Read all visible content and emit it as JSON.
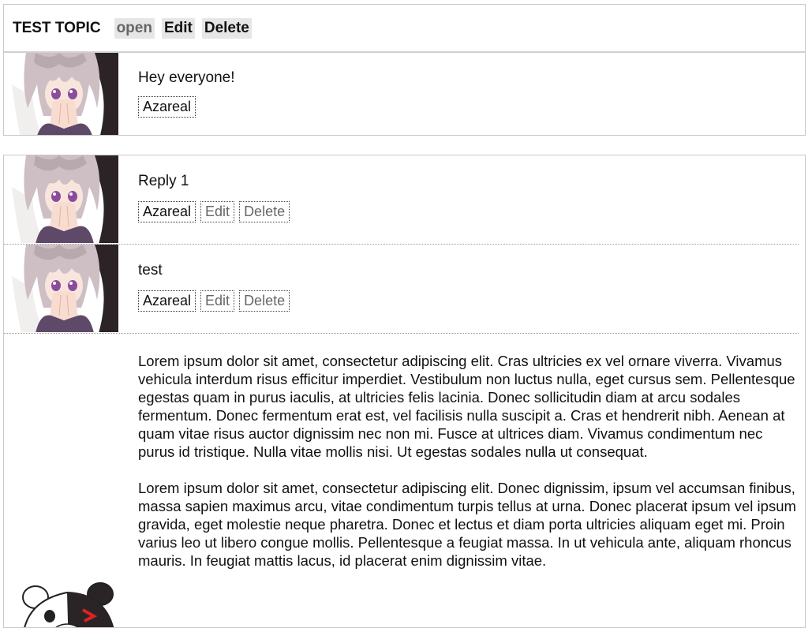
{
  "topic": {
    "title": "TEST TOPIC",
    "status": "open",
    "edit_label": "Edit",
    "delete_label": "Delete",
    "post": {
      "text": "Hey everyone!",
      "author": "Azareal"
    }
  },
  "replies": [
    {
      "text": "Reply 1",
      "author": "Azareal",
      "edit_label": "Edit",
      "delete_label": "Delete"
    },
    {
      "text": "test",
      "author": "Azareal",
      "edit_label": "Edit",
      "delete_label": "Delete"
    }
  ],
  "long_reply": {
    "paragraphs": [
      "Lorem ipsum dolor sit amet, consectetur adipiscing elit. Cras ultricies ex vel ornare viverra. Vivamus vehicula interdum risus efficitur imperdiet. Vestibulum non luctus nulla, eget cursus sem. Pellentesque egestas quam in purus iaculis, at ultricies felis lacinia. Donec sollicitudin diam at arcu sodales fermentum. Donec fermentum erat est, vel facilisis nulla suscipit a. Cras et hendrerit nibh. Aenean at quam vitae risus auctor dignissim nec non mi. Fusce at ultrices diam. Vivamus condimentum nec purus id tristique. Nulla vitae mollis nisi. Ut egestas sodales nulla ut consequat.",
      "Lorem ipsum dolor sit amet, consectetur adipiscing elit. Donec dignissim, ipsum vel accumsan finibus, massa sapien maximus arcu, vitae condimentum turpis tellus at urna. Donec placerat ipsum vel ipsum gravida, eget molestie neque pharetra. Donec et lectus et diam porta ultricies aliquam eget mi. Proin varius leo ut libero congue mollis. Pellentesque a feugiat massa. In ut vehicula ante, aliquam rhoncus mauris. In feugiat mattis lacus, id placerat enim dignissim vitae."
    ]
  },
  "icons": {
    "avatar": "anime-girl-avatar",
    "long_reply_avatar": "bear-avatar"
  }
}
